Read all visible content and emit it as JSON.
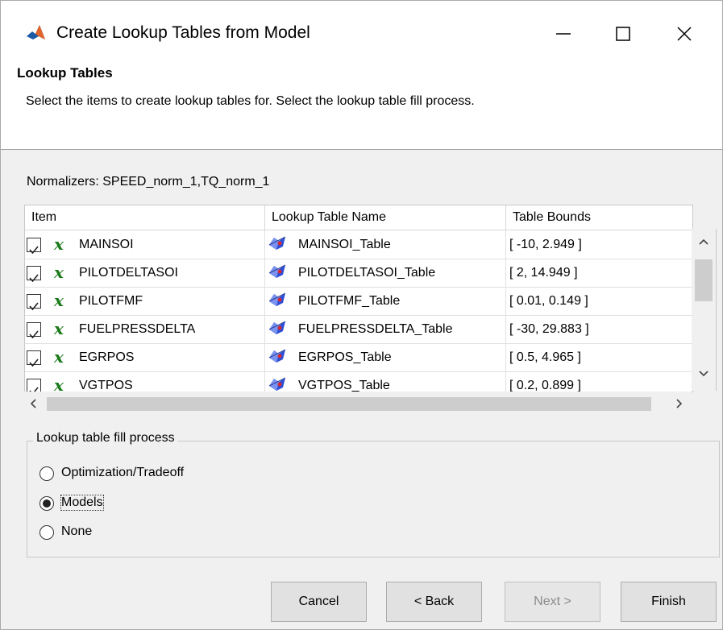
{
  "window": {
    "title": "Create Lookup Tables from Model",
    "minimize_symbol": "—",
    "maximize_symbol": "☐",
    "close_symbol": "✕"
  },
  "header": {
    "title": "Lookup Tables",
    "description": "Select the items to create lookup tables for. Select the lookup table fill process."
  },
  "normalizers": "Normalizers: SPEED_norm_1,TQ_norm_1",
  "table": {
    "columns": [
      "Item",
      "Lookup Table Name",
      "Table Bounds"
    ],
    "rows": [
      {
        "checked": true,
        "item": "MAINSOI",
        "name": "MAINSOI_Table",
        "bounds": "[ -10, 2.949 ]"
      },
      {
        "checked": true,
        "item": "PILOTDELTASOI",
        "name": "PILOTDELTASOI_Table",
        "bounds": "[ 2, 14.949 ]"
      },
      {
        "checked": true,
        "item": "PILOTFMF",
        "name": "PILOTFMF_Table",
        "bounds": "[ 0.01, 0.149 ]"
      },
      {
        "checked": true,
        "item": "FUELPRESSDELTA",
        "name": "FUELPRESSDELTA_Table",
        "bounds": "[ -30, 29.883 ]"
      },
      {
        "checked": true,
        "item": "EGRPOS",
        "name": "EGRPOS_Table",
        "bounds": "[ 0.5, 4.965 ]"
      },
      {
        "checked": true,
        "item": "VGTPOS",
        "name": "VGTPOS_Table",
        "bounds": "[ 0.2, 0.899 ]"
      }
    ],
    "variable_symbol": "x",
    "check_symbol": "✓"
  },
  "scroll": {
    "up": "˄",
    "down": "˅",
    "left": "‹",
    "right": "›"
  },
  "fill_process": {
    "legend": "Lookup table fill process",
    "options": [
      {
        "label": "Optimization/Tradeoff",
        "selected": false
      },
      {
        "label": "Models",
        "selected": true
      },
      {
        "label": "None",
        "selected": false
      }
    ]
  },
  "buttons": {
    "cancel": "Cancel",
    "back": "< Back",
    "next": "Next >",
    "finish": "Finish"
  },
  "colors": {
    "variable_icon": "#1a7a1a",
    "window_bg": "#f0f0f0",
    "accent_blue": "#1a3fd1"
  }
}
